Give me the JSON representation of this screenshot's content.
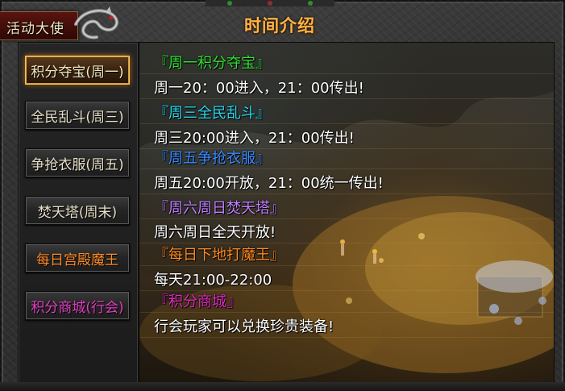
{
  "window": {
    "corner_label": "活动大使",
    "title": "时间介绍"
  },
  "menu": [
    {
      "label": "积分夺宝(周一)",
      "color": "#f4e6c0",
      "active": true
    },
    {
      "label": "全民乱斗(周三)",
      "color": "#e8e0c8",
      "active": false
    },
    {
      "label": "争抢衣服(周五)",
      "color": "#e8e0c8",
      "active": false
    },
    {
      "label": "焚天塔(周末)",
      "color": "#e8e0c8",
      "active": false
    },
    {
      "label": "每日宫殿魔王",
      "color": "#ff8c2a",
      "active": false
    },
    {
      "label": "积分商城(行会)",
      "color": "#e040c0",
      "active": false
    }
  ],
  "events": [
    {
      "name": "『周一积分夺宝』",
      "name_color": "#33e033",
      "desc": "周一20：00进入，21：00传出!"
    },
    {
      "name": "『周三全民乱斗』",
      "name_color": "#28d8f0",
      "desc": "周三20:00进入，21：00传出!"
    },
    {
      "name": "『周五争抢衣服』",
      "name_color": "#3a8cff",
      "desc": "周五20:00开放，21：00统一传出!"
    },
    {
      "name": "『周六周日焚天塔』",
      "name_color": "#c080ff",
      "desc": "周六周日全天开放!"
    },
    {
      "name": "『每日下地打魔王』",
      "name_color": "#ff8a1e",
      "desc": "每天21:00-22:00"
    },
    {
      "name": "『积分商城』",
      "name_color": "#e22cc0",
      "desc": "行会玩家可以兑换珍贵装备!"
    }
  ]
}
